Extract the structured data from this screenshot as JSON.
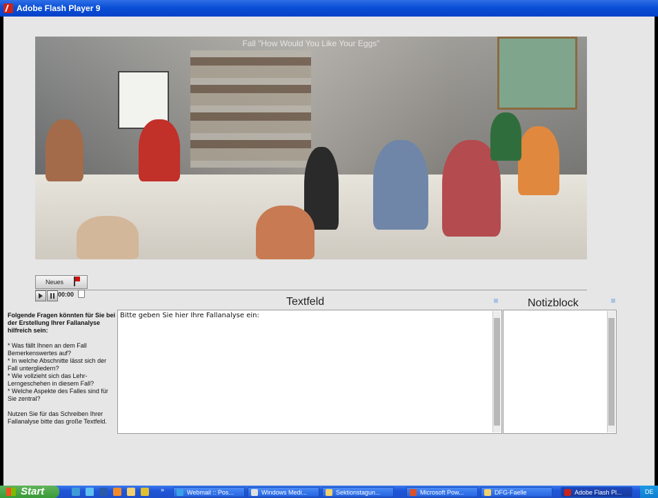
{
  "window": {
    "title": "Adobe Flash Player 9"
  },
  "video": {
    "caption": "Fall \"How Would You Like Your Eggs\""
  },
  "controls": {
    "neues_label": "Neues",
    "time": "00:00"
  },
  "headers": {
    "textfeld": "Textfeld",
    "notizblock": "Notizblock"
  },
  "sidebar": {
    "intro": "Folgende Fragen könnten für Sie bei der Erstellung Ihrer Fallanalyse hilfreich sein:",
    "q1": "* Was fällt Ihnen an dem Fall Bemerkenswertes auf?",
    "q2": "* In welche Abschnitte lässt sich der Fall untergliedern?",
    "q3": "* Wie vollzieht sich das Lehr-Lerngeschehen in diesem Fall?",
    "q4": "* Welche Aspekte des Falles sind für Sie zentral?",
    "outro": "Nutzen Sie für das Schreiben Ihrer Fallanalyse bitte das große Textfeld."
  },
  "textfeld": {
    "value": "Bitte geben Sie hier Ihre Fallanalyse ein:"
  },
  "taskbar": {
    "start_label": "Start",
    "tasks": [
      {
        "label": "Webmail :: Pos...",
        "icon": "ie-icon",
        "color": "#3aa0e8"
      },
      {
        "label": "Windows Medi...",
        "icon": "media-player-icon",
        "color": "#e0e0e0"
      },
      {
        "label": "Sektionstagun...",
        "icon": "folder-icon",
        "color": "#f2d06b"
      },
      {
        "label": "Microsoft Pow...",
        "icon": "powerpoint-icon",
        "color": "#d9532c"
      },
      {
        "label": "DFG-Faelle",
        "icon": "folder-icon",
        "color": "#f2d06b"
      },
      {
        "label": "Adobe Flash Pl...",
        "icon": "flash-icon",
        "color": "#c8231c"
      }
    ],
    "tray_label": "DE"
  }
}
